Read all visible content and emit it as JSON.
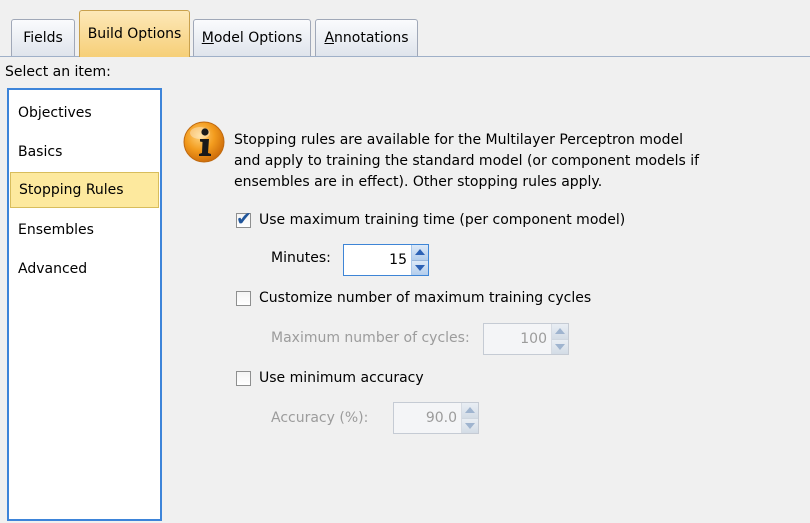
{
  "tabs": [
    {
      "label": "Fields",
      "active": false
    },
    {
      "label": "Build Options",
      "active": true
    },
    {
      "label_first": "M",
      "label_rest": "odel Options",
      "active": false
    },
    {
      "label_first": "A",
      "label_rest": "nnotations",
      "active": false
    }
  ],
  "select_label": "Select an item:",
  "items": [
    {
      "label": "Objectives",
      "selected": false
    },
    {
      "label": "Basics",
      "selected": false
    },
    {
      "label": "Stopping Rules",
      "selected": true
    },
    {
      "label": "Ensembles",
      "selected": false
    },
    {
      "label": "Advanced",
      "selected": false
    }
  ],
  "info": {
    "icon": "info-icon",
    "line1": "Stopping rules are available for the Multilayer Perceptron model",
    "line2": "and apply to training the standard model (or component models if",
    "line3": "ensembles are in effect).  Other stopping rules apply."
  },
  "max_time": {
    "checked": true,
    "label": "Use maximum training time (per component model)",
    "minutes_label": "Minutes:",
    "minutes_value": "15"
  },
  "max_cycles": {
    "checked": false,
    "label": "Customize number of maximum training cycles",
    "cycles_label": "Maximum number of cycles:",
    "cycles_value": "100"
  },
  "min_accuracy": {
    "checked": false,
    "label": "Use minimum accuracy",
    "accuracy_label": "Accuracy (%):",
    "accuracy_value": "90.0"
  },
  "colors": {
    "active_tab": "#f6cf78",
    "selected_item": "#fde99e",
    "focus_border": "#3d84d9",
    "disabled_text": "#9c9c9c"
  }
}
